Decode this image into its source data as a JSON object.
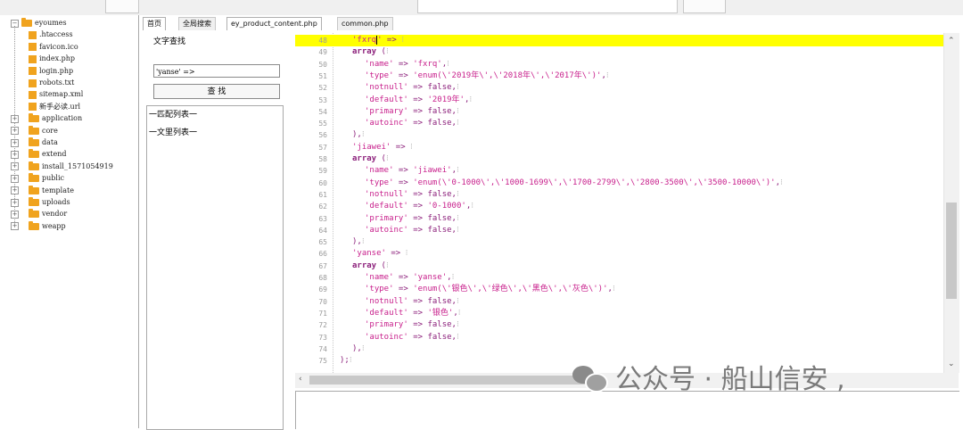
{
  "tree": {
    "root": "eyoumes",
    "items": [
      {
        "label": ".htaccess",
        "type": "file"
      },
      {
        "label": "favicon.ico",
        "type": "file"
      },
      {
        "label": "index.php",
        "type": "file"
      },
      {
        "label": "login.php",
        "type": "file"
      },
      {
        "label": "robots.txt",
        "type": "file"
      },
      {
        "label": "sitemap.xml",
        "type": "file"
      },
      {
        "label": "新手必读.url",
        "type": "file"
      },
      {
        "label": "application",
        "type": "folder"
      },
      {
        "label": "core",
        "type": "folder"
      },
      {
        "label": "data",
        "type": "folder"
      },
      {
        "label": "extend",
        "type": "folder"
      },
      {
        "label": "install_1571054919",
        "type": "folder"
      },
      {
        "label": "public",
        "type": "folder"
      },
      {
        "label": "template",
        "type": "folder"
      },
      {
        "label": "uploads",
        "type": "folder"
      },
      {
        "label": "vendor",
        "type": "folder"
      },
      {
        "label": "weapp",
        "type": "folder"
      }
    ]
  },
  "left_tabs": [
    "首页",
    "全局搜索"
  ],
  "editor_tabs": [
    "ey_product_content.php",
    "common.php"
  ],
  "search": {
    "group_label": "文字查找",
    "input_value": "'yanse' =>",
    "button_label": "查 找",
    "result_line1": "一匹配列表一",
    "result_line2": "一文里列表一"
  },
  "code": {
    "lines": [
      {
        "n": "48",
        "parts": [
          [
            "s",
            "'fxrq"
          ],
          [
            "cur",
            ""
          ],
          [
            "s",
            "'"
          ],
          [
            "k",
            " => "
          ],
          [
            "fold",
            "⁝"
          ]
        ],
        "highlight": true
      },
      {
        "n": "49",
        "parts": [
          [
            "kw",
            "array"
          ],
          [
            "k",
            " ("
          ],
          [
            "fold",
            "⁝"
          ]
        ]
      },
      {
        "n": "50",
        "parts": [
          [
            "s",
            "'name'"
          ],
          [
            "k",
            " => "
          ],
          [
            "s",
            "'fxrq'"
          ],
          [
            "k",
            ","
          ],
          [
            "fold",
            "⁝"
          ]
        ],
        "indent": 1
      },
      {
        "n": "51",
        "parts": [
          [
            "s",
            "'type'"
          ],
          [
            "k",
            " => "
          ],
          [
            "s",
            "'enum(\\'2019年\\',\\'2018年\\',\\'2017年\\')'"
          ],
          [
            "k",
            ","
          ],
          [
            "fold",
            "⁝"
          ]
        ],
        "indent": 1
      },
      {
        "n": "52",
        "parts": [
          [
            "s",
            "'notnull'"
          ],
          [
            "k",
            " => false,"
          ],
          [
            "fold",
            "⁝"
          ]
        ],
        "indent": 1
      },
      {
        "n": "53",
        "parts": [
          [
            "s",
            "'default'"
          ],
          [
            "k",
            " => "
          ],
          [
            "s",
            "'2019年'"
          ],
          [
            "k",
            ","
          ],
          [
            "fold",
            "⁝"
          ]
        ],
        "indent": 1
      },
      {
        "n": "54",
        "parts": [
          [
            "s",
            "'primary'"
          ],
          [
            "k",
            " => false,"
          ],
          [
            "fold",
            "⁝"
          ]
        ],
        "indent": 1
      },
      {
        "n": "55",
        "parts": [
          [
            "s",
            "'autoinc'"
          ],
          [
            "k",
            " => false,"
          ],
          [
            "fold",
            "⁝"
          ]
        ],
        "indent": 1
      },
      {
        "n": "56",
        "parts": [
          [
            "k",
            "),"
          ],
          [
            "fold",
            "⁝"
          ]
        ]
      },
      {
        "n": "57",
        "parts": [
          [
            "s",
            "'jiawei'"
          ],
          [
            "k",
            " => "
          ],
          [
            "fold",
            "⁝"
          ]
        ]
      },
      {
        "n": "58",
        "parts": [
          [
            "kw",
            "array"
          ],
          [
            "k",
            " ("
          ],
          [
            "fold",
            "⁝"
          ]
        ]
      },
      {
        "n": "59",
        "parts": [
          [
            "s",
            "'name'"
          ],
          [
            "k",
            " => "
          ],
          [
            "s",
            "'jiawei'"
          ],
          [
            "k",
            ","
          ],
          [
            "fold",
            "⁝"
          ]
        ],
        "indent": 1
      },
      {
        "n": "60",
        "parts": [
          [
            "s",
            "'type'"
          ],
          [
            "k",
            " => "
          ],
          [
            "s",
            "'enum(\\'0-1000\\',\\'1000-1699\\',\\'1700-2799\\',\\'2800-3500\\',\\'3500-10000\\')'"
          ],
          [
            "k",
            ","
          ],
          [
            "fold",
            "⁝"
          ]
        ],
        "indent": 1
      },
      {
        "n": "61",
        "parts": [
          [
            "s",
            "'notnull'"
          ],
          [
            "k",
            " => false,"
          ],
          [
            "fold",
            "⁝"
          ]
        ],
        "indent": 1
      },
      {
        "n": "62",
        "parts": [
          [
            "s",
            "'default'"
          ],
          [
            "k",
            " => "
          ],
          [
            "s",
            "'0-1000'"
          ],
          [
            "k",
            ","
          ],
          [
            "fold",
            "⁝"
          ]
        ],
        "indent": 1
      },
      {
        "n": "63",
        "parts": [
          [
            "s",
            "'primary'"
          ],
          [
            "k",
            " => false,"
          ],
          [
            "fold",
            "⁝"
          ]
        ],
        "indent": 1
      },
      {
        "n": "64",
        "parts": [
          [
            "s",
            "'autoinc'"
          ],
          [
            "k",
            " => false,"
          ],
          [
            "fold",
            "⁝"
          ]
        ],
        "indent": 1
      },
      {
        "n": "65",
        "parts": [
          [
            "k",
            "),"
          ],
          [
            "fold",
            "⁝"
          ]
        ]
      },
      {
        "n": "66",
        "parts": [
          [
            "s",
            "'yanse'"
          ],
          [
            "k",
            " => "
          ],
          [
            "fold",
            "⁝"
          ]
        ]
      },
      {
        "n": "67",
        "parts": [
          [
            "kw",
            "array"
          ],
          [
            "k",
            " ("
          ],
          [
            "fold",
            "⁝"
          ]
        ]
      },
      {
        "n": "68",
        "parts": [
          [
            "s",
            "'name'"
          ],
          [
            "k",
            " => "
          ],
          [
            "s",
            "'yanse'"
          ],
          [
            "k",
            ","
          ],
          [
            "fold",
            "⁝"
          ]
        ],
        "indent": 1
      },
      {
        "n": "69",
        "parts": [
          [
            "s",
            "'type'"
          ],
          [
            "k",
            " => "
          ],
          [
            "s",
            "'enum(\\'银色\\',\\'绿色\\',\\'黑色\\',\\'灰色\\')'"
          ],
          [
            "k",
            ","
          ],
          [
            "fold",
            "⁝"
          ]
        ],
        "indent": 1
      },
      {
        "n": "70",
        "parts": [
          [
            "s",
            "'notnull'"
          ],
          [
            "k",
            " => false,"
          ],
          [
            "fold",
            "⁝"
          ]
        ],
        "indent": 1
      },
      {
        "n": "71",
        "parts": [
          [
            "s",
            "'default'"
          ],
          [
            "k",
            " => "
          ],
          [
            "s",
            "'银色'"
          ],
          [
            "k",
            ","
          ],
          [
            "fold",
            "⁝"
          ]
        ],
        "indent": 1
      },
      {
        "n": "72",
        "parts": [
          [
            "s",
            "'primary'"
          ],
          [
            "k",
            " => false,"
          ],
          [
            "fold",
            "⁝"
          ]
        ],
        "indent": 1
      },
      {
        "n": "73",
        "parts": [
          [
            "s",
            "'autoinc'"
          ],
          [
            "k",
            " => false,"
          ],
          [
            "fold",
            "⁝"
          ]
        ],
        "indent": 1
      },
      {
        "n": "74",
        "parts": [
          [
            "k",
            "),"
          ],
          [
            "fold",
            "⁝"
          ]
        ]
      },
      {
        "n": "75",
        "parts": [
          [
            "k",
            ");"
          ],
          [
            "fold",
            "⁝"
          ]
        ],
        "indent": -1
      }
    ]
  },
  "watermark": {
    "text": "公众号 · 船山信安 ,"
  },
  "colors": {
    "highlight": "#ffff00",
    "keyword": "#8b1e7a",
    "string": "#c8208c",
    "folder": "#f0a31e"
  }
}
